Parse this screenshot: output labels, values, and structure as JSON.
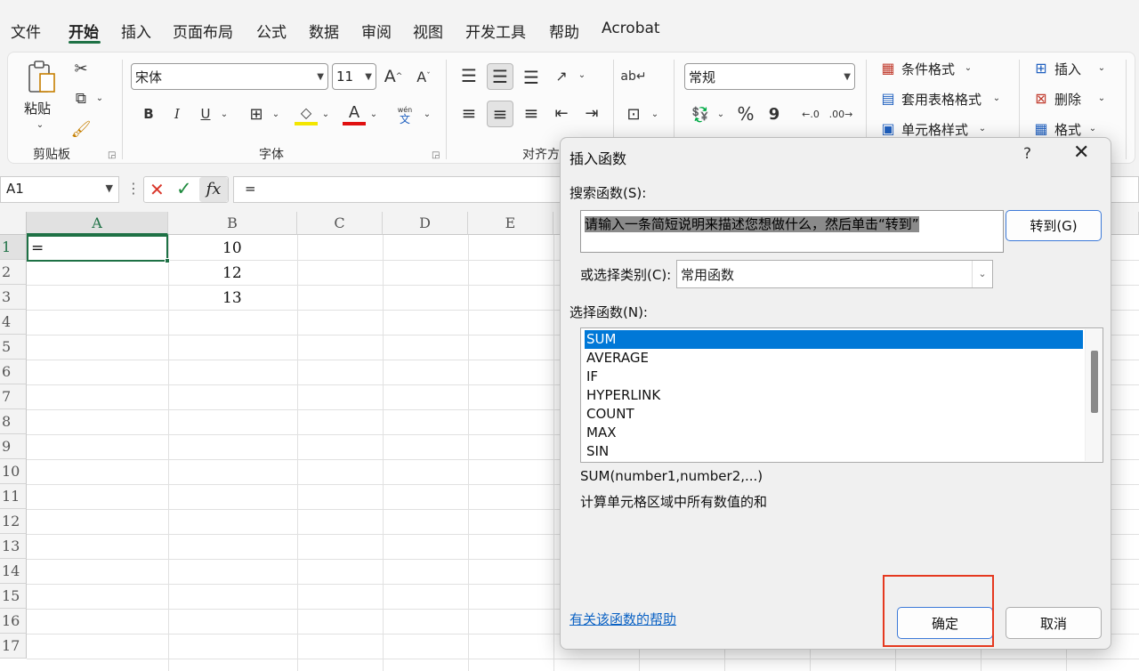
{
  "menu": {
    "tabs": [
      "文件",
      "开始",
      "插入",
      "页面布局",
      "公式",
      "数据",
      "审阅",
      "视图",
      "开发工具",
      "帮助",
      "Acrobat"
    ],
    "active_tab": "开始"
  },
  "ribbon": {
    "clipboard": {
      "paste_label": "粘贴",
      "group_label": "剪贴板"
    },
    "font": {
      "font_name": "宋体",
      "font_size": "11",
      "grow_label": "A",
      "shrink_label": "A",
      "phonetic_top": "wén",
      "phonetic_bottom": "文",
      "bold": "B",
      "italic": "I",
      "underline": "U",
      "font_color_label": "A",
      "group_label": "字体"
    },
    "alignment": {
      "group_label": "对齐方"
    },
    "number": {
      "format": "常规",
      "percent": "%",
      "comma": "9"
    },
    "styles": {
      "conditional": "条件格式",
      "table": "套用表格格式",
      "cell_styles": "单元格样式"
    },
    "cells": {
      "insert": "插入",
      "delete": "删除",
      "format": "格式"
    }
  },
  "formula_bar": {
    "name_box": "A1",
    "fx_label": "fx",
    "formula": "="
  },
  "sheet": {
    "columns": [
      "A",
      "B",
      "C",
      "D",
      "E"
    ],
    "rows": [
      "1",
      "2",
      "3",
      "4",
      "5",
      "6",
      "7",
      "8",
      "9",
      "10",
      "11",
      "12",
      "13",
      "14",
      "15",
      "16",
      "17"
    ],
    "cells": {
      "A1": "=",
      "B1": "10",
      "B2": "12",
      "B3": "13"
    }
  },
  "dialog": {
    "title": "插入函数",
    "help": "?",
    "close": "✕",
    "search_label": "搜索函数(S):",
    "search_value": "请输入一条简短说明来描述您想做什么，然后单击“转到”",
    "go_button": "转到(G)",
    "category_label": "或选择类别(C):",
    "category_value": "常用函数",
    "select_label": "选择函数(N):",
    "functions": [
      "SUM",
      "AVERAGE",
      "IF",
      "HYPERLINK",
      "COUNT",
      "MAX",
      "SIN"
    ],
    "selected_function": "SUM",
    "signature": "SUM(number1,number2,...)",
    "description": "计算单元格区域中所有数值的和",
    "help_link": "有关该函数的帮助",
    "ok_button": "确定",
    "cancel_button": "取消"
  },
  "colors": {
    "excel_green": "#1e7145",
    "selection_blue": "#0078d7",
    "highlight_red": "#e53920",
    "link_blue": "#0b62c4"
  }
}
